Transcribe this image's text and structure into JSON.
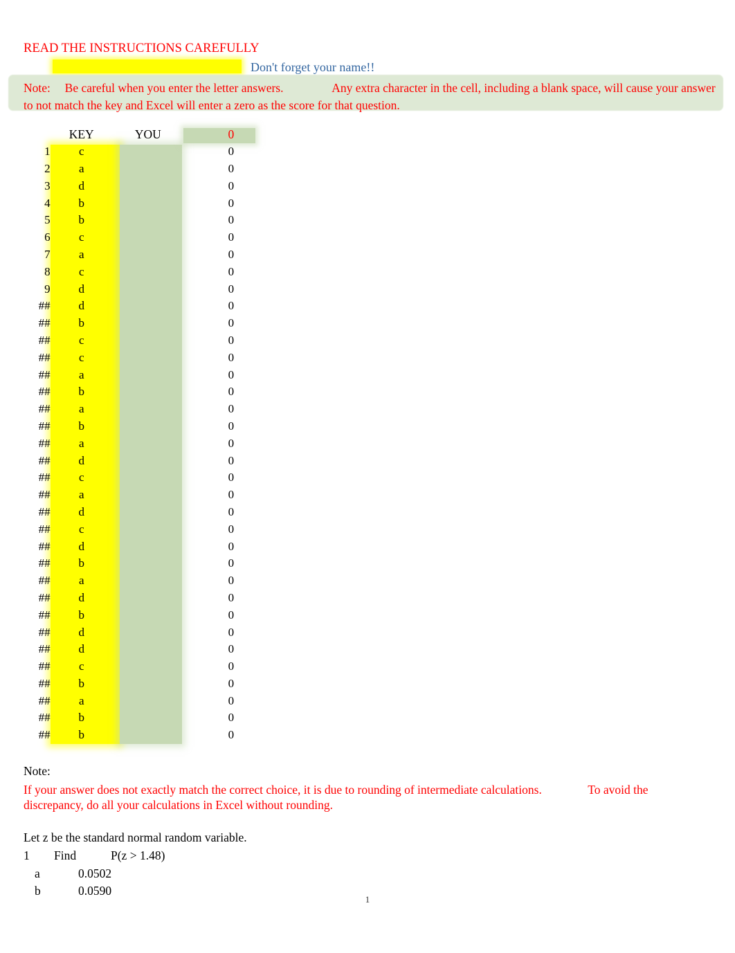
{
  "header": {
    "title": "READ THE INSTRUCTIONS CAREFULLY",
    "name_reminder": "Don't forget your name!!",
    "note_label": "Note:",
    "note_part1": "Be careful when you enter the letter answers.",
    "note_part2": "Any extra character in the cell, including a blank space, will cause your answer to not match the key and Excel will enter a zero as the score for that question."
  },
  "table": {
    "columns": {
      "number": "",
      "key": "KEY",
      "you": "YOU",
      "score": "0"
    },
    "rows": [
      {
        "num": "1",
        "key": "c",
        "you": "",
        "score": "0"
      },
      {
        "num": "2",
        "key": "a",
        "you": "",
        "score": "0"
      },
      {
        "num": "3",
        "key": "d",
        "you": "",
        "score": "0"
      },
      {
        "num": "4",
        "key": "b",
        "you": "",
        "score": "0"
      },
      {
        "num": "5",
        "key": "b",
        "you": "",
        "score": "0"
      },
      {
        "num": "6",
        "key": "c",
        "you": "",
        "score": "0"
      },
      {
        "num": "7",
        "key": "a",
        "you": "",
        "score": "0"
      },
      {
        "num": "8",
        "key": "c",
        "you": "",
        "score": "0"
      },
      {
        "num": "9",
        "key": "d",
        "you": "",
        "score": "0"
      },
      {
        "num": "##",
        "key": "d",
        "you": "",
        "score": "0"
      },
      {
        "num": "##",
        "key": "b",
        "you": "",
        "score": "0"
      },
      {
        "num": "##",
        "key": "c",
        "you": "",
        "score": "0"
      },
      {
        "num": "##",
        "key": "c",
        "you": "",
        "score": "0"
      },
      {
        "num": "##",
        "key": "a",
        "you": "",
        "score": "0"
      },
      {
        "num": "##",
        "key": "b",
        "you": "",
        "score": "0"
      },
      {
        "num": "##",
        "key": "a",
        "you": "",
        "score": "0"
      },
      {
        "num": "##",
        "key": "b",
        "you": "",
        "score": "0"
      },
      {
        "num": "##",
        "key": "a",
        "you": "",
        "score": "0"
      },
      {
        "num": "##",
        "key": "d",
        "you": "",
        "score": "0"
      },
      {
        "num": "##",
        "key": "c",
        "you": "",
        "score": "0"
      },
      {
        "num": "##",
        "key": "a",
        "you": "",
        "score": "0"
      },
      {
        "num": "##",
        "key": "d",
        "you": "",
        "score": "0"
      },
      {
        "num": "##",
        "key": "c",
        "you": "",
        "score": "0"
      },
      {
        "num": "##",
        "key": "d",
        "you": "",
        "score": "0"
      },
      {
        "num": "##",
        "key": "b",
        "you": "",
        "score": "0"
      },
      {
        "num": "##",
        "key": "a",
        "you": "",
        "score": "0"
      },
      {
        "num": "##",
        "key": "d",
        "you": "",
        "score": "0"
      },
      {
        "num": "##",
        "key": "b",
        "you": "",
        "score": "0"
      },
      {
        "num": "##",
        "key": "d",
        "you": "",
        "score": "0"
      },
      {
        "num": "##",
        "key": "d",
        "you": "",
        "score": "0"
      },
      {
        "num": "##",
        "key": "c",
        "you": "",
        "score": "0"
      },
      {
        "num": "##",
        "key": "b",
        "you": "",
        "score": "0"
      },
      {
        "num": "##",
        "key": "a",
        "you": "",
        "score": "0"
      },
      {
        "num": "##",
        "key": "b",
        "you": "",
        "score": "0"
      },
      {
        "num": "##",
        "key": "b",
        "you": "",
        "score": "0"
      }
    ]
  },
  "bottom_note": {
    "label": "Note:",
    "line1": "If your answer does not exactly match the correct choice, it is due to rounding of intermediate calculations.",
    "line2": "To avoid the discrepancy, do all your calculations in Excel without rounding."
  },
  "question": {
    "intro": "Let z be the standard normal random variable.",
    "number": "1",
    "verb": "Find",
    "expression": "P(z > 1.48)",
    "options": [
      {
        "letter": "a",
        "value": "0.0502"
      },
      {
        "letter": "b",
        "value": "0.0590"
      }
    ]
  },
  "footer": {
    "page_number": "1"
  },
  "colors": {
    "red": "#FF0000",
    "blue": "#3366A0",
    "yellow_highlight": "#FFFF00",
    "green_highlight": "#C6D9B4",
    "note_band": "#DCE8D2"
  }
}
